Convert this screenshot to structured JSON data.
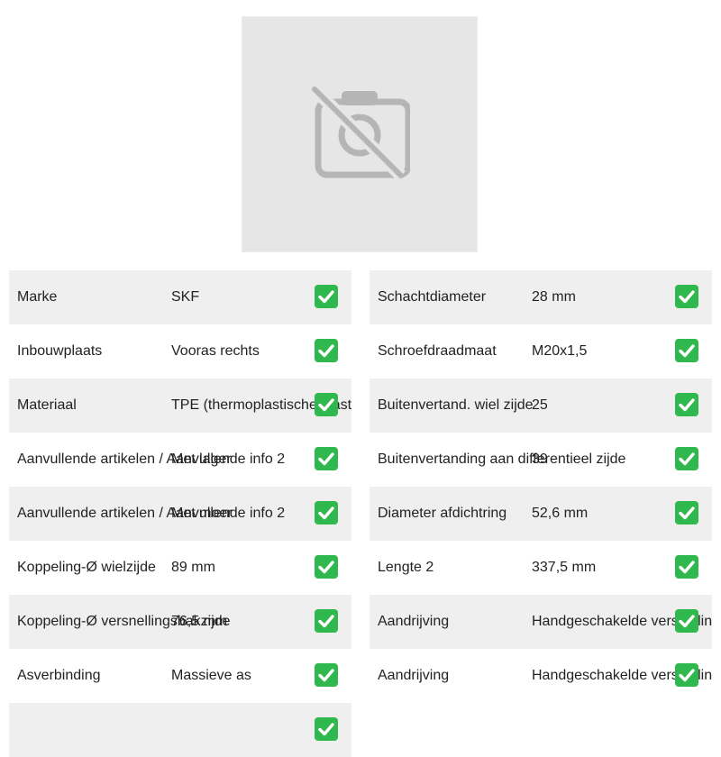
{
  "image": {
    "icon": "no-photo-icon"
  },
  "colors": {
    "row_shade": "#efefef",
    "check_green": "#2fb84e",
    "placeholder_bg": "#e6e6e6"
  },
  "specs": {
    "left": [
      {
        "label": "Marke",
        "value": "SKF",
        "status_icon": "check-icon"
      },
      {
        "label": "Inbouwplaats",
        "value": "Vooras rechts",
        "status_icon": "check-icon"
      },
      {
        "label": "Materiaal",
        "value": "TPE (thermoplastische elastomeer)",
        "status_icon": "check-icon"
      },
      {
        "label": "Aanvullende artikelen / Aanvullende info 2",
        "value": "Met lager",
        "status_icon": "check-icon"
      },
      {
        "label": "Aanvullende artikelen / Aanvullende info 2",
        "value": "Met moer",
        "status_icon": "check-icon"
      },
      {
        "label": "Koppeling-Ø wielzijde",
        "value": "89 mm",
        "status_icon": "check-icon"
      },
      {
        "label": "Koppeling-Ø versnellingsbakzijde",
        "value": "76,5 mm",
        "status_icon": "check-icon"
      },
      {
        "label": "Asverbinding",
        "value": "Massieve as",
        "status_icon": "check-icon"
      },
      {
        "label": "",
        "value": "",
        "status_icon": "check-icon"
      }
    ],
    "right": [
      {
        "label": "Schachtdiameter",
        "value": "28 mm",
        "status_icon": "check-icon"
      },
      {
        "label": "Schroefdraadmaat",
        "value": "M20x1,5",
        "status_icon": "check-icon"
      },
      {
        "label": "Buitenvertand. wiel zijde",
        "value": "25",
        "status_icon": "check-icon"
      },
      {
        "label": "Buitenvertanding aan differentieel zijde",
        "value": "39",
        "status_icon": "check-icon"
      },
      {
        "label": "Diameter afdichtring",
        "value": "52,6 mm",
        "status_icon": "check-icon"
      },
      {
        "label": "Lengte 2",
        "value": "337,5 mm",
        "status_icon": "check-icon"
      },
      {
        "label": "Aandrijving",
        "value": "Handgeschakelde versnellingsbak",
        "status_icon": "check-icon"
      },
      {
        "label": "Aandrijving",
        "value": "Handgeschakelde versnellingsbak",
        "status_icon": "check-icon"
      }
    ]
  }
}
